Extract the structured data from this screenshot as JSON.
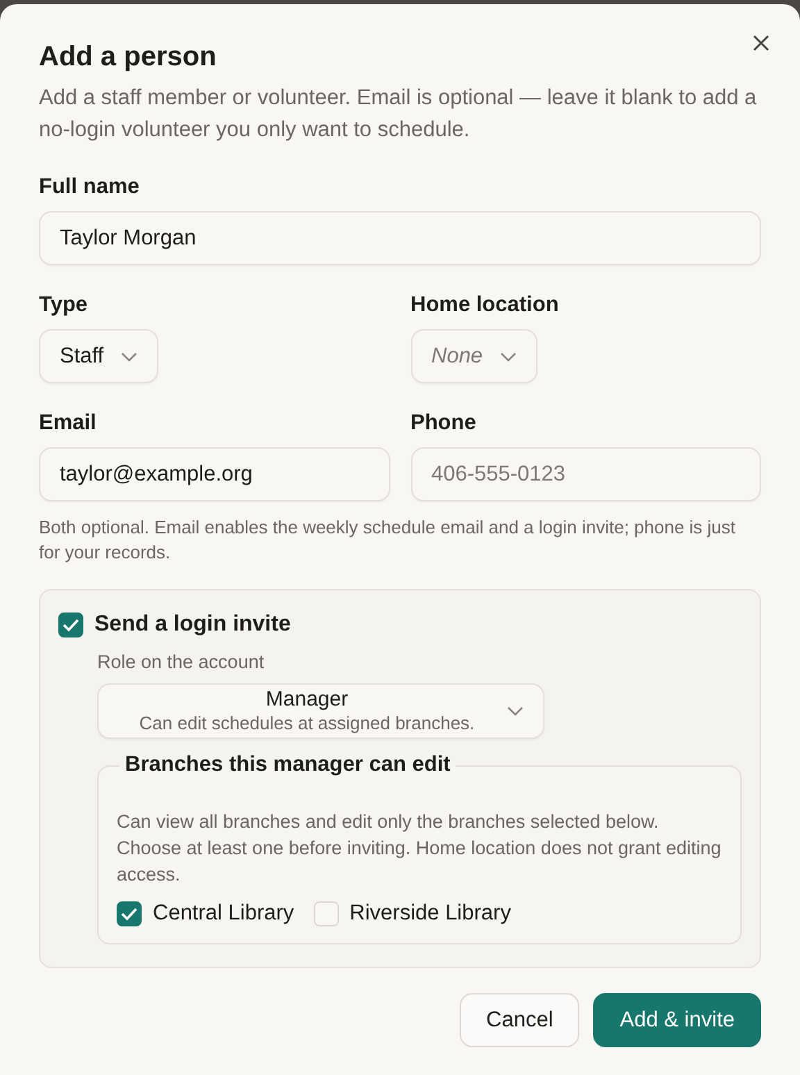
{
  "dialog": {
    "title": "Add a person",
    "description": "Add a staff member or volunteer. Email is optional — leave it blank to add a no-login volunteer you only want to schedule."
  },
  "full_name": {
    "label": "Full name",
    "value": "Taylor Morgan"
  },
  "type": {
    "label": "Type",
    "value": "Staff"
  },
  "home_location": {
    "label": "Home location",
    "placeholder": "None"
  },
  "email": {
    "label": "Email",
    "value": "taylor@example.org"
  },
  "phone": {
    "label": "Phone",
    "placeholder": "406-555-0123"
  },
  "contact_help": "Both optional. Email enables the weekly schedule email and a login invite; phone is just for your records.",
  "invite": {
    "label": "Send a login invite",
    "checked": true,
    "role_label": "Role on the account",
    "role": {
      "value": "Manager",
      "description": "Can edit schedules at assigned branches."
    },
    "branches": {
      "legend": "Branches this manager can edit",
      "help": "Can view all branches and edit only the branches selected below. Choose at least one before inviting. Home location does not grant editing access.",
      "items": [
        {
          "label": "Central Library",
          "checked": true
        },
        {
          "label": "Riverside Library",
          "checked": false
        }
      ]
    }
  },
  "buttons": [
    {
      "label": "Cancel",
      "kind": "secondary"
    },
    {
      "label": "Add & invite",
      "kind": "primary"
    }
  ]
}
